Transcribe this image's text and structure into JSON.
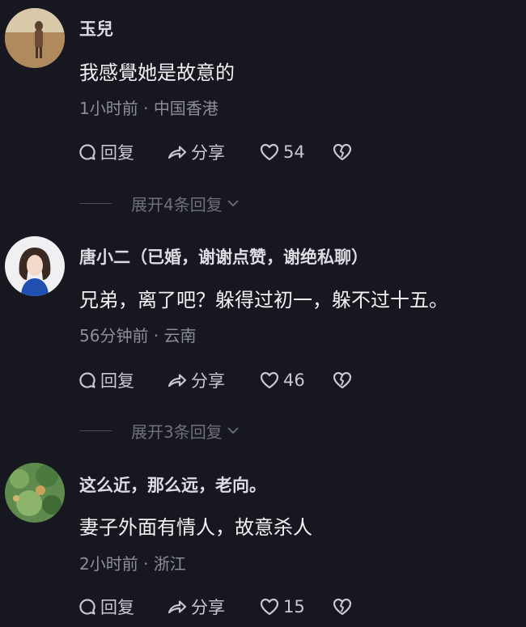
{
  "comments": [
    {
      "username": "玉兒",
      "text": "我感覺她是故意的",
      "time": "1小时前",
      "location": "中国香港",
      "reply_label": "回复",
      "share_label": "分享",
      "likes": "54",
      "expand_label": "展开4条回复"
    },
    {
      "username": "唐小二（已婚，谢谢点赞，谢绝私聊）",
      "text": "兄弟，离了吧？躲得过初一，躲不过十五。",
      "time": "56分钟前",
      "location": "云南",
      "reply_label": "回复",
      "share_label": "分享",
      "likes": "46",
      "expand_label": "展开3条回复"
    },
    {
      "username": "这么近，那么远，老向。",
      "text": "妻子外面有情人，故意杀人",
      "time": "2小时前",
      "location": "浙江",
      "reply_label": "回复",
      "share_label": "分享",
      "likes": "15"
    }
  ],
  "meta_separator": " · ",
  "icons": [
    "comment-bubble-icon",
    "share-arrow-icon",
    "heart-icon",
    "broken-heart-icon",
    "chevron-down-icon"
  ],
  "colors": {
    "background": "#16171f",
    "text": "#f2f2f5",
    "meta": "#8d8e98",
    "action": "#c8c8d0"
  }
}
